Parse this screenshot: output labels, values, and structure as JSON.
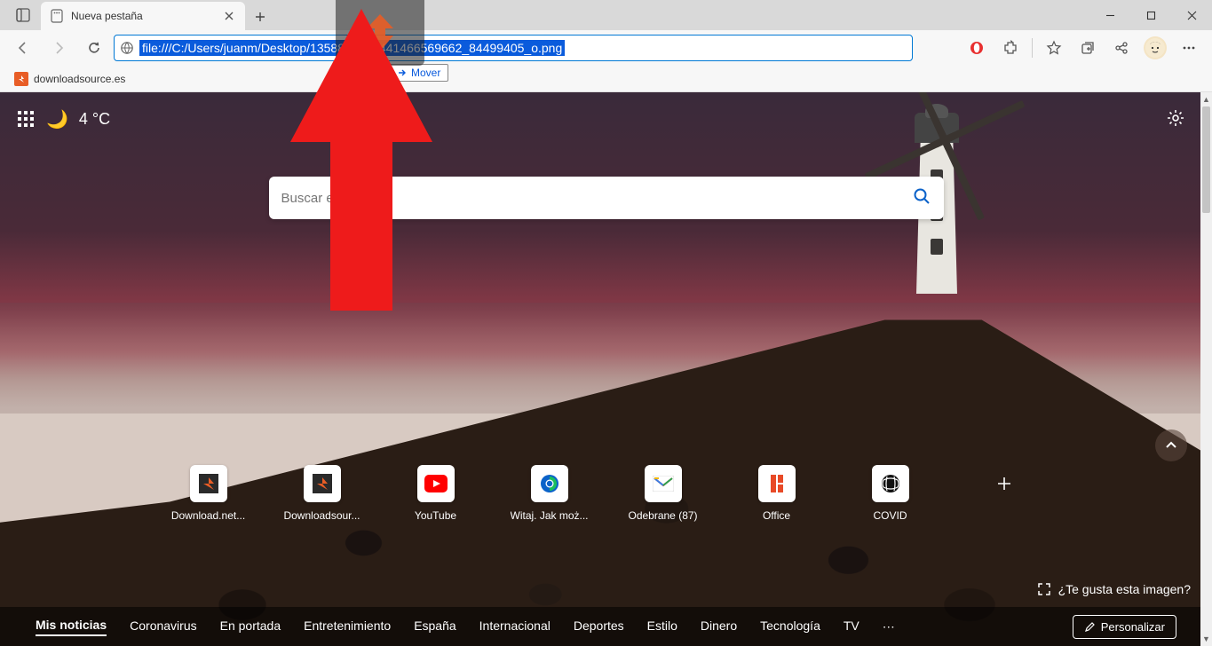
{
  "tab": {
    "title": "Nueva pestaña"
  },
  "address": {
    "url": "file:///C:/Users/juanm/Desktop/135887_534441466569662_84499405_o.png"
  },
  "bookmarks": [
    {
      "label": "downloadsource.es"
    }
  ],
  "mover_tooltip": "Mover",
  "ntp": {
    "temperature": "4 °C",
    "search_placeholder": "Buscar en la Web",
    "like_prompt": "¿Te gusta esta imagen?",
    "quicklinks": [
      {
        "label": "Download.net..."
      },
      {
        "label": "Downloadsour..."
      },
      {
        "label": "YouTube"
      },
      {
        "label": "Witaj. Jak moż..."
      },
      {
        "label": "Odebrane (87)"
      },
      {
        "label": "Office"
      },
      {
        "label": "COVID"
      }
    ],
    "news_nav": [
      "Mis noticias",
      "Coronavirus",
      "En portada",
      "Entretenimiento",
      "España",
      "Internacional",
      "Deportes",
      "Estilo",
      "Dinero",
      "Tecnología",
      "TV"
    ],
    "personalize": "Personalizar"
  }
}
